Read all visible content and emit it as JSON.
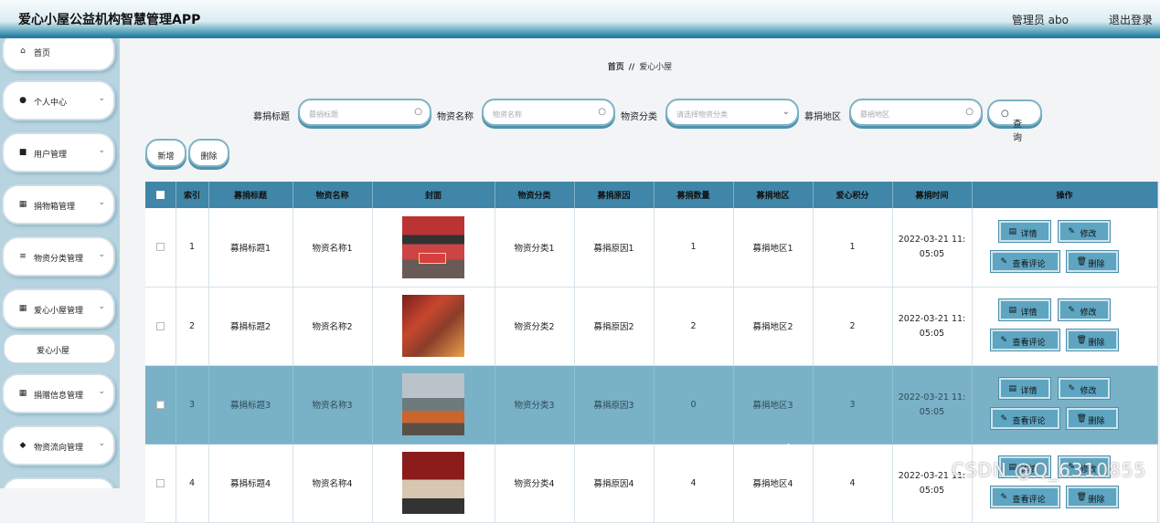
{
  "header": {
    "title": "爱心小屋公益机构智慧管理APP",
    "admin": "管理员 abo",
    "logout": "退出登录"
  },
  "sidebar": {
    "items": [
      {
        "icon": "⌂",
        "label": "首页",
        "chevron": false
      },
      {
        "icon": "●",
        "label": "个人中心",
        "chevron": true
      },
      {
        "icon": "■",
        "label": "用户管理",
        "chevron": true
      },
      {
        "icon": "▦",
        "label": "捐物箱管理",
        "chevron": true
      },
      {
        "icon": "≡",
        "label": "物资分类管理",
        "chevron": true
      },
      {
        "icon": "▦",
        "label": "爱心小屋管理",
        "chevron": true
      },
      {
        "icon": "▦",
        "label": "捐赠信息管理",
        "chevron": true
      },
      {
        "icon": "◆",
        "label": "物资流向管理",
        "chevron": true
      }
    ],
    "sub_item": "爱心小屋"
  },
  "breadcrumb": {
    "home": "首页",
    "sep": "//",
    "current": "爱心小屋"
  },
  "filters": {
    "title_label": "募捐标题",
    "title_placeholder": "募捐标题",
    "name_label": "物资名称",
    "name_placeholder": "物资名称",
    "category_label": "物资分类",
    "category_placeholder": "请选择物资分类",
    "region_label": "募捐地区",
    "region_placeholder": "募捐地区",
    "query_label": "查询"
  },
  "toolbar": {
    "add_label": "新增",
    "delete_label": "删除"
  },
  "table": {
    "headers": [
      "索引",
      "募捐标题",
      "物资名称",
      "封面",
      "物资分类",
      "募捐原因",
      "募捐数量",
      "募捐地区",
      "爱心积分",
      "募捐时间",
      "操作"
    ],
    "rows": [
      {
        "index": "1",
        "title": "募捐标题1",
        "name": "物资名称1",
        "category": "物资分类1",
        "reason": "募捐原因1",
        "qty": "1",
        "region": "募捐地区1",
        "points": "1",
        "time1": "2022-03-21 11:",
        "time2": "05:05"
      },
      {
        "index": "2",
        "title": "募捐标题2",
        "name": "物资名称2",
        "category": "物资分类2",
        "reason": "募捐原因2",
        "qty": "2",
        "region": "募捐地区2",
        "points": "2",
        "time1": "2022-03-21 11:",
        "time2": "05:05"
      },
      {
        "index": "3",
        "title": "募捐标题3",
        "name": "物资名称3",
        "category": "物资分类3",
        "reason": "募捐原因3",
        "qty": "0",
        "region": "募捐地区3",
        "points": "3",
        "time1": "2022-03-21 11:",
        "time2": "05:05"
      },
      {
        "index": "4",
        "title": "募捐标题4",
        "name": "物资名称4",
        "category": "物资分类4",
        "reason": "募捐原因4",
        "qty": "4",
        "region": "募捐地区4",
        "points": "4",
        "time1": "2022-03-21 11:",
        "time2": "05:05"
      }
    ],
    "actions": {
      "detail": "详情",
      "edit": "修改",
      "comments": "查看评论",
      "delete": "删除"
    }
  },
  "watermark": "CSDN @Q_6310855",
  "colors": {
    "header_bar": "#2e7ea0",
    "table_header": "#3f86a8",
    "selected_row": "#79b1c7",
    "sidebar": "#b7d4e0"
  }
}
